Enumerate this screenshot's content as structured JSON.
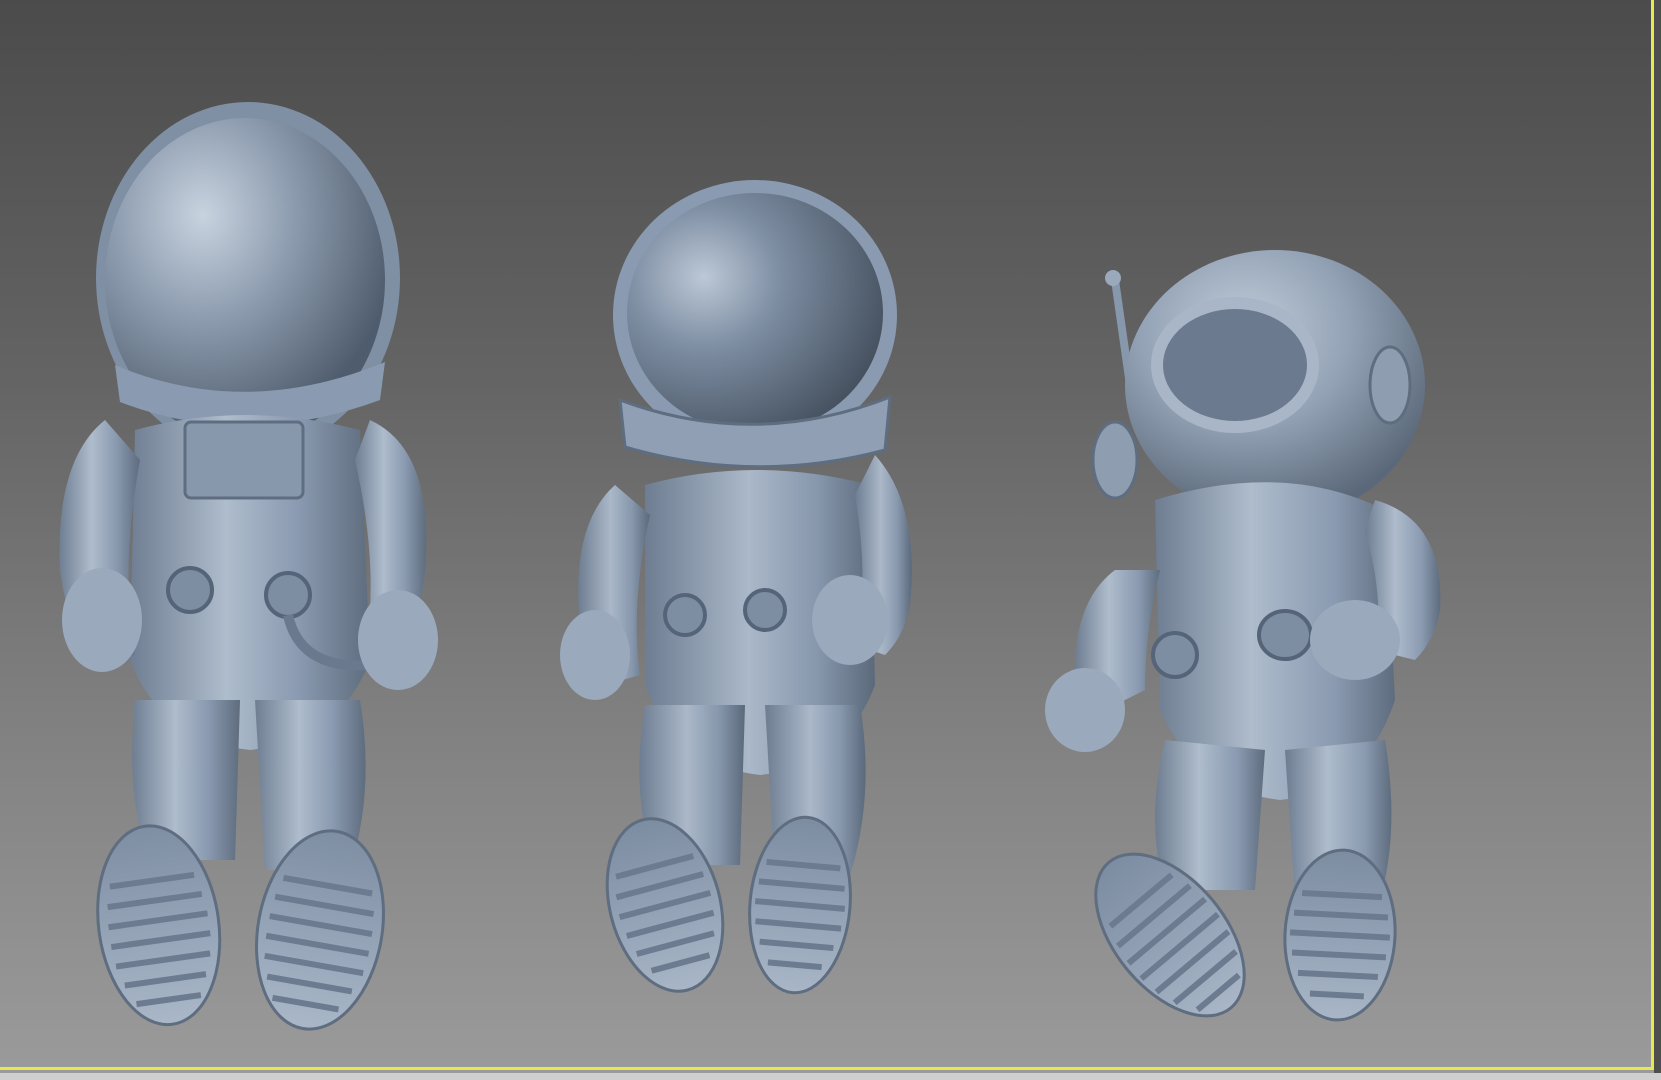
{
  "scene": {
    "description_free": true,
    "colors": {
      "background_top": "#4b4b4b",
      "background_bottom": "#9b9b9b",
      "viewport_border": "#e8e850",
      "model_light": "#b9c6d6",
      "model_mid": "#8b9cb1",
      "model_dark": "#5b6a7c"
    },
    "models": [
      {
        "name": "astronaut-model-front",
        "view": "front"
      },
      {
        "name": "astronaut-model-front-alt",
        "view": "front"
      },
      {
        "name": "astronaut-model-three-quarter",
        "view": "three-quarter"
      }
    ]
  }
}
